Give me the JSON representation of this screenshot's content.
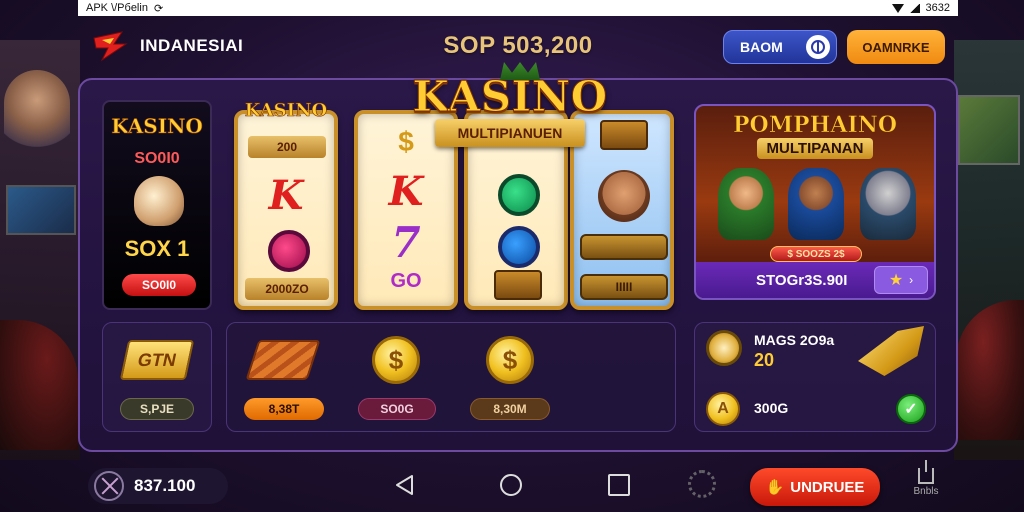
{
  "status_bar": {
    "left_text": "APK \\/Pбelin",
    "right_text": "3632"
  },
  "header": {
    "brand": "INDANESIAI",
    "balance_title": "SOP 503,200",
    "blue_button_label": "BAOM",
    "orange_button_label": "OAMNRKE"
  },
  "hero": {
    "title": "KASINO",
    "ribbon": "MULTIPIANUEN"
  },
  "left_card": {
    "title": "KASINO",
    "subtitle": "SO0I0",
    "amount": "SOX 1",
    "pill": "SO0I0"
  },
  "reels": [
    {
      "title": "KASINO",
      "top_plate": "200",
      "symbol": "K",
      "bottom_plate": "2000ZO"
    },
    {
      "symbol_top": "$",
      "symbol": "K",
      "symbol_7": "7",
      "bottom_text": "GO"
    },
    {
      "symbol": "O"
    },
    {
      "top_plate": "",
      "banner": "IIIII"
    }
  ],
  "promo": {
    "title": "POMPHAINO",
    "subtitle": "MULTIPANAN",
    "mini_pill": "$ SOOZS 2$",
    "bar_text": "STOGr3S.90I",
    "star": "★"
  },
  "tiles": {
    "gold_block_label": "GTN",
    "tile_a_pill": "S,PJE",
    "items": [
      {
        "pill": "8,38T",
        "style": "orange"
      },
      {
        "coin": "$",
        "pill": "SO0G",
        "style": "maroon"
      },
      {
        "coin": "$",
        "pill": "8,30M",
        "style": "brown"
      }
    ]
  },
  "rewards": {
    "title": "MAGS 2O9a",
    "number": "20",
    "line": "300G",
    "coin": "A",
    "check": "✓"
  },
  "nav": {
    "wallet_amount": "837.100",
    "cta_label": "UNDRUEE",
    "share_label": "Bnbls"
  },
  "colors": {
    "accent_gold": "#ffcc33",
    "accent_purple": "#6b4aa0",
    "cta_red": "#c8180a"
  }
}
